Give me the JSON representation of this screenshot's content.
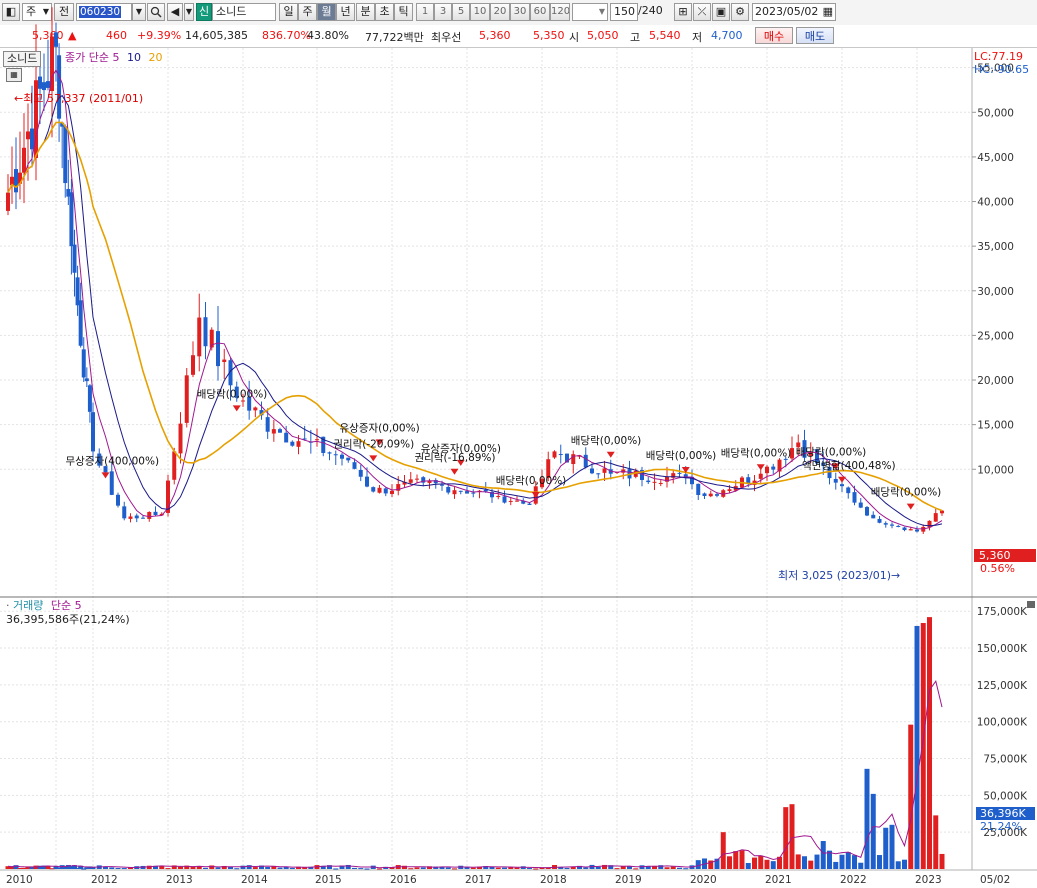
{
  "toolbar": {
    "market_type": "주",
    "prev_label": "전",
    "code": "060230",
    "name_tag": "신",
    "stock_name": "소니드",
    "periods": [
      "일",
      "주",
      "월",
      "년",
      "분",
      "초",
      "틱"
    ],
    "active_period": "월",
    "intervals": [
      "1",
      "3",
      "5",
      "10",
      "20",
      "30",
      "60",
      "120"
    ],
    "count": "150",
    "count_total": "/240",
    "date": "2023/05/02"
  },
  "quote": {
    "price": "5,360",
    "change": "460",
    "change_pct": "+9.39%",
    "volume": "14,605,385",
    "volume_ratio": "836.70%",
    "turnover": "43.80%",
    "amount": "77,722백만",
    "best_bid_label": "최우선",
    "best_ask": "5,360",
    "best_bid": "5,350",
    "open_label": "시",
    "open": "5,050",
    "high_label": "고",
    "high": "5,540",
    "low_label": "저",
    "low": "4,700",
    "buy_label": "매수",
    "sell_label": "매도"
  },
  "price_panel": {
    "name_tag": "소니드",
    "legend_prefix": "종가 단순",
    "ma_periods": [
      "5",
      "10",
      "20"
    ],
    "ma_colors": [
      "#a01890",
      "#1a1a8a",
      "#e6a000"
    ],
    "lc_label": "LC:77.19",
    "hc_label": "HC:-90.65",
    "last_price": "5,360",
    "last_pct": "0.56%",
    "high_marker": "최고 57,337 (2011/01)",
    "low_marker": "최저 3,025 (2023/01)"
  },
  "volume_panel": {
    "title": "거래량",
    "ma_label": "단순 5",
    "summary": "36,395,586주(21,24%)",
    "last_volume": "36,396K",
    "last_pct": "21,24%"
  },
  "annotations": [
    {
      "text": "무상증자(400,00%)",
      "date": "2012/03",
      "price": 11000
    },
    {
      "text": "배당락(0,00%)",
      "date": "2013/12",
      "price": 18500
    },
    {
      "text": "유상증자(0,00%)",
      "date": "2015/11",
      "price": 14700
    },
    {
      "text": "권리락(-20,09%)",
      "date": "2015/10",
      "price": 12900
    },
    {
      "text": "유상증자(0,00%)",
      "date": "2016/12",
      "price": 12400
    },
    {
      "text": "권리락(-16,89%)",
      "date": "2016/11",
      "price": 11400
    },
    {
      "text": "배당락(0,00%)",
      "date": "2017/12",
      "price": 8800
    },
    {
      "text": "배당락(0,00%)",
      "date": "2018/12",
      "price": 13300
    },
    {
      "text": "배당락(0,00%)",
      "date": "2019/12",
      "price": 11600
    },
    {
      "text": "배당락(0,00%)",
      "date": "2020/12",
      "price": 11900
    },
    {
      "text": "배당락(0,00%)",
      "date": "2021/12",
      "price": 12000
    },
    {
      "text": "액면병합(400,48%)",
      "date": "2022/01",
      "price": 10500
    },
    {
      "text": "배당락(0,00%)",
      "date": "2022/12",
      "price": 7500
    }
  ],
  "chart_data": [
    {
      "type": "candlestick",
      "title": "소니드 월봉",
      "y_axis_ticks": [
        55000,
        50000,
        45000,
        40000,
        35000,
        30000,
        25000,
        20000,
        15000,
        10000
      ],
      "x_axis_labels": [
        "2010",
        "2012",
        "2013",
        "2014",
        "2015",
        "2016",
        "2017",
        "2018",
        "2019",
        "2020",
        "2021",
        "2022",
        "2023",
        "05/02"
      ],
      "moving_averages": [
        5,
        10,
        20
      ],
      "price_anchors": [
        {
          "date": "2010/01",
          "close": 41000
        },
        {
          "date": "2011/01",
          "close": 57337
        },
        {
          "date": "2011/06",
          "close": 35000
        },
        {
          "date": "2012/01",
          "close": 12000
        },
        {
          "date": "2012/06",
          "close": 4500
        },
        {
          "date": "2012/12",
          "close": 5000
        },
        {
          "date": "2013/06",
          "close": 27000
        },
        {
          "date": "2013/12",
          "close": 18000
        },
        {
          "date": "2014/06",
          "close": 14500
        },
        {
          "date": "2015/06",
          "close": 11000
        },
        {
          "date": "2015/10",
          "close": 7500
        },
        {
          "date": "2016/06",
          "close": 8500
        },
        {
          "date": "2017/06",
          "close": 7000
        },
        {
          "date": "2017/11",
          "close": 6000
        },
        {
          "date": "2018/03",
          "close": 12000
        },
        {
          "date": "2018/12",
          "close": 9500
        },
        {
          "date": "2019/12",
          "close": 9000
        },
        {
          "date": "2020/03",
          "close": 7000
        },
        {
          "date": "2020/12",
          "close": 9500
        },
        {
          "date": "2021/06",
          "close": 13000
        },
        {
          "date": "2021/12",
          "close": 8500
        },
        {
          "date": "2022/06",
          "close": 4500
        },
        {
          "date": "2023/01",
          "close": 3025
        },
        {
          "date": "2023/05",
          "close": 5360
        }
      ],
      "ylim": [
        0,
        58000
      ]
    },
    {
      "type": "bar",
      "title": "거래량",
      "y_axis_ticks": [
        "175,000K",
        "150,000K",
        "125,000K",
        "100,000K",
        "75,000K",
        "50,000K",
        "25,000K"
      ],
      "ylim": [
        0,
        180000
      ],
      "unit": "K",
      "bars": [
        {
          "date": "2020/06",
          "value": 25000
        },
        {
          "date": "2021/04",
          "value": 42000
        },
        {
          "date": "2021/05",
          "value": 44000
        },
        {
          "date": "2021/10",
          "value": 19000
        },
        {
          "date": "2022/05",
          "value": 68000
        },
        {
          "date": "2022/06",
          "value": 51000
        },
        {
          "date": "2022/08",
          "value": 28000
        },
        {
          "date": "2022/09",
          "value": 30000
        },
        {
          "date": "2022/12",
          "value": 98000
        },
        {
          "date": "2023/01",
          "value": 165000
        },
        {
          "date": "2023/02",
          "value": 167000
        },
        {
          "date": "2023/03",
          "value": 171000
        },
        {
          "date": "2023/04",
          "value": 36396
        }
      ]
    }
  ]
}
